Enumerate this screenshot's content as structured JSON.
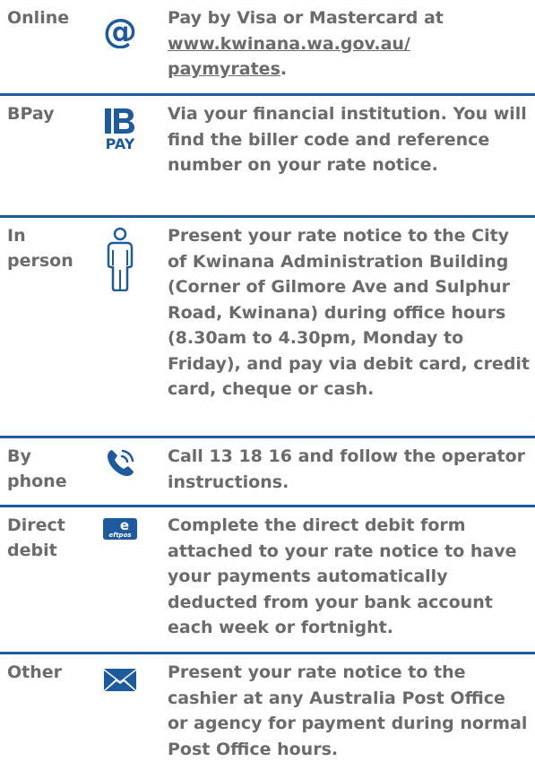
{
  "colors": {
    "text": "#6b6b6b",
    "accent": "#1d5a9e",
    "rule": "#1d5a9e"
  },
  "rows": [
    {
      "method": "Online",
      "icon": "at-sign-icon",
      "text_before": "Pay by Visa or Mastercard at ",
      "link": "www.kwinana.wa.gov.au/ paymyrates",
      "text_after": "."
    },
    {
      "method": "BPay",
      "icon": "bpay-logo-icon",
      "text": "Via your financial institution. You will find the biller code and reference number on your rate notice."
    },
    {
      "method": "In person",
      "icon": "person-icon",
      "text": "Present your rate notice to the City of Kwinana Administration Building (Corner of Gilmore Ave and Sulphur Road, Kwinana) during office hours (8.30am to 4.30pm, Monday to Friday), and pay via debit card, credit card, cheque or cash."
    },
    {
      "method": "By phone",
      "icon": "phone-icon",
      "text": "Call 13 18 16 and follow the operator instructions."
    },
    {
      "method": "Direct debit",
      "icon": "eftpos-logo-icon",
      "text": "Complete the direct debit form attached to your rate notice to have your payments automatically deducted from your bank account each week or fortnight."
    },
    {
      "method": "Other",
      "icon": "envelope-icon",
      "text": "Present your rate notice to the cashier at any Australia Post Office or agency for payment during normal Post Office hours."
    }
  ]
}
